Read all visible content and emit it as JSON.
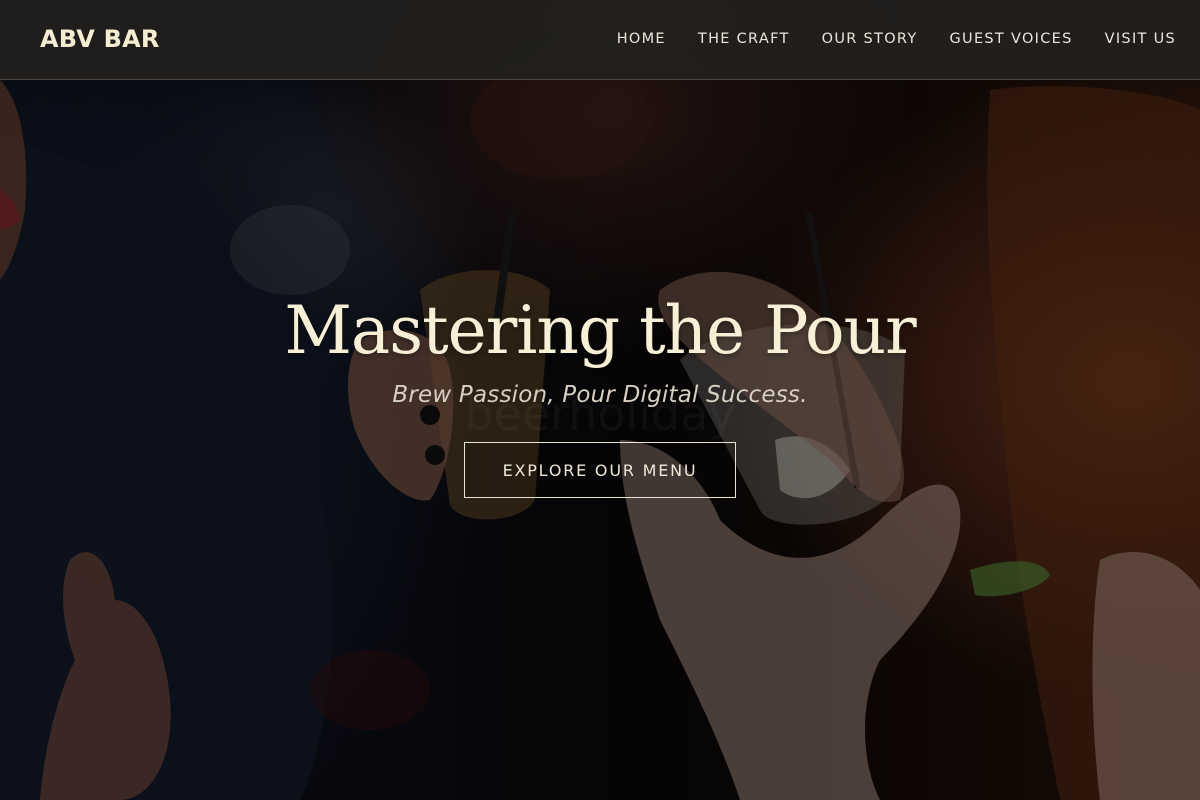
{
  "header": {
    "logo": "ABV BAR",
    "nav": [
      {
        "label": "HOME"
      },
      {
        "label": "THE CRAFT"
      },
      {
        "label": "OUR STORY"
      },
      {
        "label": "GUEST VOICES"
      },
      {
        "label": "VISIT US"
      }
    ]
  },
  "hero": {
    "title": "Mastering the Pour",
    "tagline": "Brew Passion, Pour Digital Success.",
    "cta_label": "EXPLORE OUR MENU",
    "image_icon": "bar-crowd-toasting-drinks-photo"
  },
  "colors": {
    "header_bg": "#22201e",
    "logo": "#f5edd2",
    "title": "#f7f0d6",
    "tagline": "#d7cfc2",
    "cta_border": "#eae3cf"
  }
}
